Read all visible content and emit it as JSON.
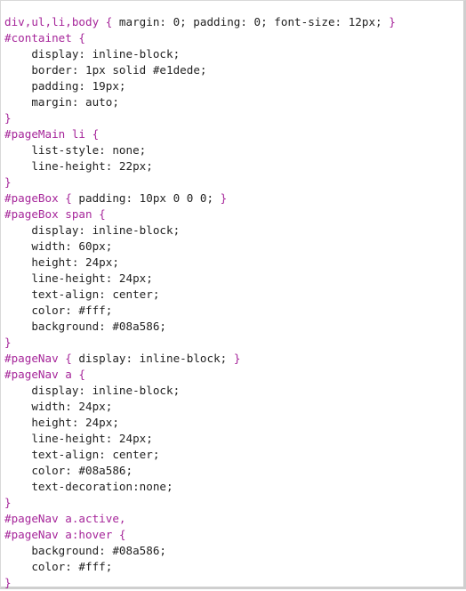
{
  "editor": {
    "lines": [
      {
        "indent": false,
        "segments": [
          {
            "type": "sel",
            "text": "div,ul,li,body"
          },
          {
            "type": "punct",
            "text": " { "
          },
          {
            "type": "prop",
            "text": "margin: 0; padding: 0; font-size: 12px;"
          },
          {
            "type": "punct",
            "text": " }"
          }
        ]
      },
      {
        "indent": false,
        "segments": [
          {
            "type": "sel",
            "text": "#containet"
          },
          {
            "type": "punct",
            "text": " {"
          }
        ]
      },
      {
        "indent": true,
        "segments": [
          {
            "type": "prop",
            "text": "display: inline-block;"
          }
        ]
      },
      {
        "indent": true,
        "segments": [
          {
            "type": "prop",
            "text": "border: 1px solid #e1dede;"
          }
        ]
      },
      {
        "indent": true,
        "segments": [
          {
            "type": "prop",
            "text": "padding: 19px;"
          }
        ]
      },
      {
        "indent": true,
        "segments": [
          {
            "type": "prop",
            "text": "margin: auto;"
          }
        ]
      },
      {
        "indent": false,
        "segments": [
          {
            "type": "punct",
            "text": "}"
          }
        ]
      },
      {
        "indent": false,
        "segments": [
          {
            "type": "sel",
            "text": "#pageMain li"
          },
          {
            "type": "punct",
            "text": " {"
          }
        ]
      },
      {
        "indent": true,
        "segments": [
          {
            "type": "prop",
            "text": "list-style: none;"
          }
        ]
      },
      {
        "indent": true,
        "segments": [
          {
            "type": "prop",
            "text": "line-height: 22px;"
          }
        ]
      },
      {
        "indent": false,
        "segments": [
          {
            "type": "punct",
            "text": "}"
          }
        ]
      },
      {
        "indent": false,
        "segments": [
          {
            "type": "sel",
            "text": "#pageBox"
          },
          {
            "type": "punct",
            "text": " { "
          },
          {
            "type": "prop",
            "text": "padding: 10px 0 0 0;"
          },
          {
            "type": "punct",
            "text": " }"
          }
        ]
      },
      {
        "indent": false,
        "segments": [
          {
            "type": "sel",
            "text": "#pageBox span"
          },
          {
            "type": "punct",
            "text": " {"
          }
        ]
      },
      {
        "indent": true,
        "segments": [
          {
            "type": "prop",
            "text": "display: inline-block;"
          }
        ]
      },
      {
        "indent": true,
        "segments": [
          {
            "type": "prop",
            "text": "width: 60px;"
          }
        ]
      },
      {
        "indent": true,
        "segments": [
          {
            "type": "prop",
            "text": "height: 24px;"
          }
        ]
      },
      {
        "indent": true,
        "segments": [
          {
            "type": "prop",
            "text": "line-height: 24px;"
          }
        ]
      },
      {
        "indent": true,
        "segments": [
          {
            "type": "prop",
            "text": "text-align: center;"
          }
        ]
      },
      {
        "indent": true,
        "segments": [
          {
            "type": "prop",
            "text": "color: #fff;"
          }
        ]
      },
      {
        "indent": true,
        "segments": [
          {
            "type": "prop",
            "text": "background: #08a586;"
          }
        ]
      },
      {
        "indent": false,
        "segments": [
          {
            "type": "punct",
            "text": "}"
          }
        ]
      },
      {
        "indent": false,
        "segments": [
          {
            "type": "sel",
            "text": "#pageNav"
          },
          {
            "type": "punct",
            "text": " { "
          },
          {
            "type": "prop",
            "text": "display: inline-block;"
          },
          {
            "type": "punct",
            "text": " }"
          }
        ]
      },
      {
        "indent": false,
        "segments": [
          {
            "type": "sel",
            "text": "#pageNav a"
          },
          {
            "type": "punct",
            "text": " {"
          }
        ]
      },
      {
        "indent": true,
        "segments": [
          {
            "type": "prop",
            "text": "display: inline-block;"
          }
        ]
      },
      {
        "indent": true,
        "segments": [
          {
            "type": "prop",
            "text": "width: 24px;"
          }
        ]
      },
      {
        "indent": true,
        "segments": [
          {
            "type": "prop",
            "text": "height: 24px;"
          }
        ]
      },
      {
        "indent": true,
        "segments": [
          {
            "type": "prop",
            "text": "line-height: 24px;"
          }
        ]
      },
      {
        "indent": true,
        "segments": [
          {
            "type": "prop",
            "text": "text-align: center;"
          }
        ]
      },
      {
        "indent": true,
        "segments": [
          {
            "type": "prop",
            "text": "color: #08a586;"
          }
        ]
      },
      {
        "indent": true,
        "segments": [
          {
            "type": "prop",
            "text": "text-decoration:none;"
          }
        ]
      },
      {
        "indent": false,
        "segments": [
          {
            "type": "punct",
            "text": "}"
          }
        ]
      },
      {
        "indent": false,
        "segments": [
          {
            "type": "sel",
            "text": "#pageNav a.active,"
          }
        ]
      },
      {
        "indent": false,
        "segments": [
          {
            "type": "sel",
            "text": "#pageNav a:hover"
          },
          {
            "type": "punct",
            "text": " {"
          }
        ]
      },
      {
        "indent": true,
        "segments": [
          {
            "type": "prop",
            "text": "background: #08a586;"
          }
        ]
      },
      {
        "indent": true,
        "segments": [
          {
            "type": "prop",
            "text": "color: #fff;"
          }
        ]
      },
      {
        "indent": false,
        "segments": [
          {
            "type": "punct",
            "text": "}"
          }
        ]
      }
    ]
  },
  "colors": {
    "selector": "#a6269a",
    "property": "#222222",
    "background": "#ffffff"
  }
}
